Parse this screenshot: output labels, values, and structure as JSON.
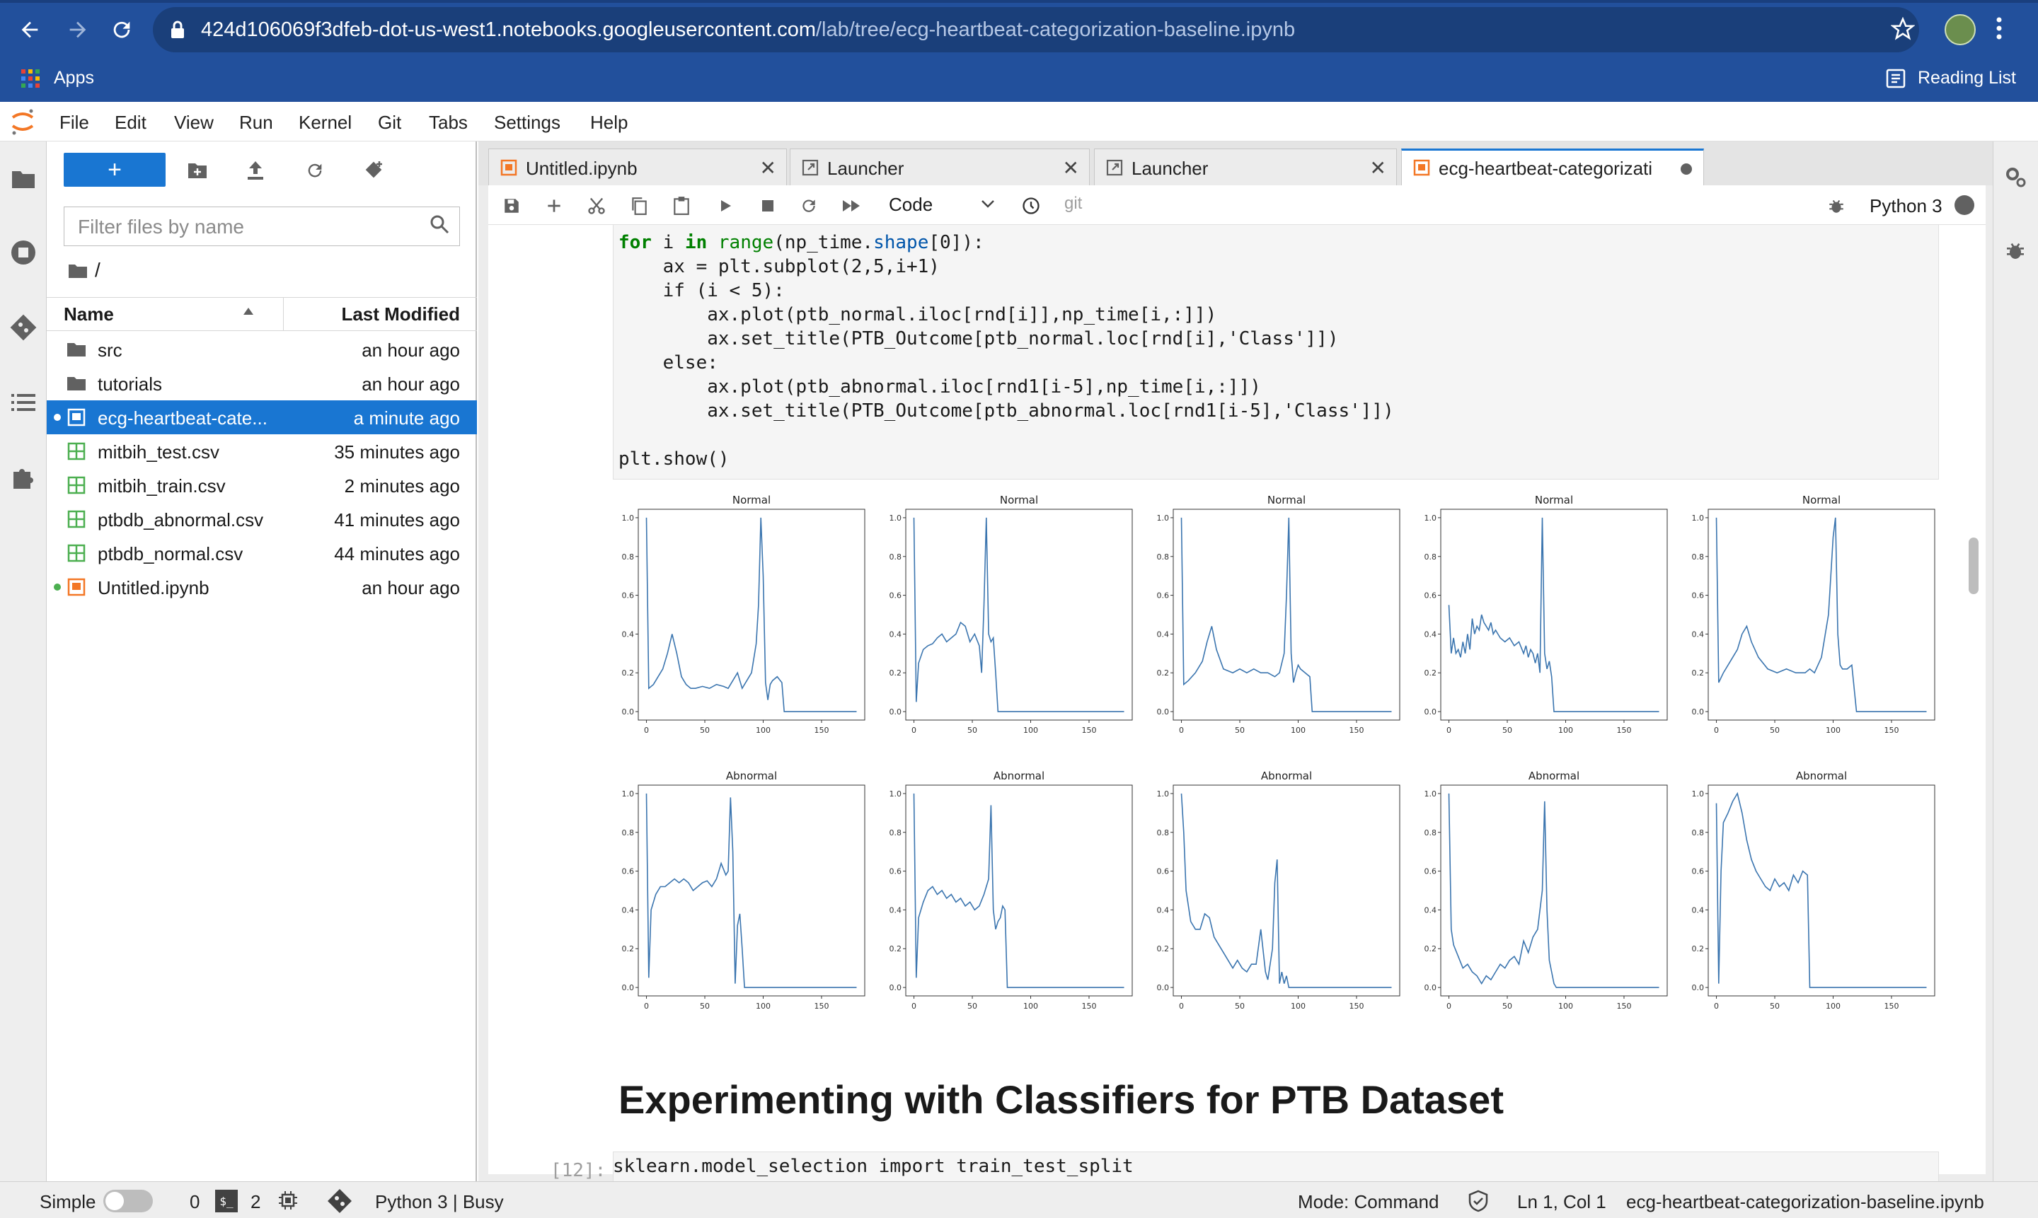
{
  "browser": {
    "url_host": "424d106069f3dfeb-dot-us-west1.notebooks.googleusercontent.com",
    "url_path": "/lab/tree/ecg-heartbeat-categorization-baseline.ipynb",
    "apps_label": "Apps",
    "reading_list_label": "Reading List"
  },
  "menu": [
    "File",
    "Edit",
    "View",
    "Run",
    "Kernel",
    "Git",
    "Tabs",
    "Settings",
    "Help"
  ],
  "file_browser": {
    "filter_placeholder": "Filter files by name",
    "breadcrumb": "/",
    "col_name": "Name",
    "col_modified": "Last Modified",
    "files": [
      {
        "name": "src",
        "modified": "an hour ago",
        "type": "folder"
      },
      {
        "name": "tutorials",
        "modified": "an hour ago",
        "type": "folder"
      },
      {
        "name": "ecg-heartbeat-cate...",
        "modified": "a minute ago",
        "type": "notebook",
        "selected": true
      },
      {
        "name": "mitbih_test.csv",
        "modified": "35 minutes ago",
        "type": "csv"
      },
      {
        "name": "mitbih_train.csv",
        "modified": "2 minutes ago",
        "type": "csv"
      },
      {
        "name": "ptbdb_abnormal.csv",
        "modified": "41 minutes ago",
        "type": "csv"
      },
      {
        "name": "ptbdb_normal.csv",
        "modified": "44 minutes ago",
        "type": "csv"
      },
      {
        "name": "Untitled.ipynb",
        "modified": "an hour ago",
        "type": "notebook"
      }
    ]
  },
  "tabs": [
    {
      "label": "Untitled.ipynb"
    },
    {
      "label": "Launcher"
    },
    {
      "label": "Launcher"
    },
    {
      "label": "ecg-heartbeat-categorizati"
    }
  ],
  "toolbar": {
    "cell_type": "Code",
    "git_label": "git",
    "kernel": "Python 3"
  },
  "code": {
    "line1": [
      "for",
      " i ",
      "in",
      " ",
      "range",
      "(np_time.",
      "shape",
      "[0]):"
    ],
    "line2": "    ax = plt.subplot(2,5,i+1)",
    "line3": "    if (i < 5):",
    "line4": "        ax.plot(ptb_normal.iloc[rnd[i]],np_time[i,:]])",
    "line5": "        ax.set_title(PTB_Outcome[ptb_normal.loc[rnd[i],'Class']])",
    "line6": "    else:",
    "line7": "        ax.plot(ptb_abnormal.iloc[rnd1[i-5],np_time[i,:]])",
    "line8": "        ax.set_title(PTB_Outcome[ptb_abnormal.loc[rnd1[i-5],'Class']])",
    "line9": "plt.show()"
  },
  "heading": "Experimenting with Classifiers for PTB Dataset",
  "next_cell": {
    "prompt": "[12]:",
    "code": "sklearn.model_selection import train_test_split"
  },
  "statusbar": {
    "mode_simple": "Simple",
    "count0": "0",
    "count2": "2",
    "kernel_status": "Python 3 | Busy",
    "mode": "Mode: Command",
    "cursor": "Ln 1, Col 1",
    "filename": "ecg-heartbeat-categorization-baseline.ipynb"
  },
  "chart_data": [
    {
      "type": "line",
      "title": "Normal",
      "xticks": [
        "0",
        "50",
        "100",
        "150"
      ],
      "yticks": [
        "0.0",
        "0.2",
        "0.4",
        "0.6",
        "0.8",
        "1.0"
      ],
      "ylim": [
        0,
        1
      ],
      "xlim": [
        -7,
        187
      ],
      "x": [
        0,
        2,
        6,
        10,
        14,
        18,
        22,
        26,
        30,
        34,
        38,
        42,
        48,
        54,
        60,
        66,
        70,
        74,
        78,
        82,
        86,
        90,
        94,
        96,
        98,
        100,
        102,
        104,
        106,
        108,
        112,
        116,
        118,
        120,
        122,
        126,
        140,
        160,
        180
      ],
      "y": [
        1.0,
        0.12,
        0.14,
        0.18,
        0.22,
        0.3,
        0.4,
        0.3,
        0.18,
        0.14,
        0.12,
        0.12,
        0.13,
        0.12,
        0.14,
        0.13,
        0.12,
        0.16,
        0.2,
        0.12,
        0.16,
        0.2,
        0.35,
        0.55,
        1.0,
        0.7,
        0.15,
        0.06,
        0.14,
        0.16,
        0.18,
        0.15,
        0.0,
        0.0,
        0.0,
        0.0,
        0.0,
        0.0,
        0.0
      ]
    },
    {
      "type": "line",
      "title": "Normal",
      "xticks": [
        "0",
        "50",
        "100",
        "150"
      ],
      "yticks": [
        "0.0",
        "0.2",
        "0.4",
        "0.6",
        "0.8",
        "1.0"
      ],
      "ylim": [
        0,
        1
      ],
      "xlim": [
        -7,
        187
      ],
      "x": [
        0,
        2,
        4,
        8,
        12,
        16,
        20,
        24,
        28,
        32,
        36,
        40,
        44,
        48,
        52,
        56,
        58,
        60,
        62,
        64,
        66,
        68,
        70,
        72,
        76,
        80,
        90,
        110,
        130,
        160,
        180
      ],
      "y": [
        1.0,
        0.05,
        0.25,
        0.32,
        0.34,
        0.35,
        0.38,
        0.4,
        0.36,
        0.38,
        0.4,
        0.46,
        0.44,
        0.36,
        0.4,
        0.34,
        0.2,
        0.55,
        1.0,
        0.4,
        0.36,
        0.38,
        0.2,
        0.0,
        0.0,
        0.0,
        0.0,
        0.0,
        0.0,
        0.0,
        0.0
      ]
    },
    {
      "type": "line",
      "title": "Normal",
      "xticks": [
        "0",
        "50",
        "100",
        "150"
      ],
      "yticks": [
        "0.0",
        "0.2",
        "0.4",
        "0.6",
        "0.8",
        "1.0"
      ],
      "ylim": [
        0,
        1
      ],
      "xlim": [
        -7,
        187
      ],
      "x": [
        0,
        2,
        6,
        12,
        18,
        22,
        26,
        30,
        36,
        44,
        50,
        56,
        62,
        68,
        74,
        80,
        84,
        88,
        90,
        92,
        94,
        96,
        98,
        100,
        102,
        106,
        110,
        112,
        116,
        130,
        150,
        180
      ],
      "y": [
        1.0,
        0.14,
        0.16,
        0.2,
        0.26,
        0.36,
        0.44,
        0.32,
        0.22,
        0.2,
        0.22,
        0.2,
        0.22,
        0.2,
        0.2,
        0.18,
        0.2,
        0.3,
        0.6,
        1.0,
        0.3,
        0.15,
        0.2,
        0.24,
        0.22,
        0.2,
        0.18,
        0.0,
        0.0,
        0.0,
        0.0,
        0.0
      ]
    },
    {
      "type": "line",
      "title": "Normal",
      "xticks": [
        "0",
        "50",
        "100",
        "150"
      ],
      "yticks": [
        "0.0",
        "0.2",
        "0.4",
        "0.6",
        "0.8",
        "1.0"
      ],
      "ylim": [
        0,
        1
      ],
      "xlim": [
        -7,
        187
      ],
      "x": [
        0,
        2,
        4,
        6,
        8,
        10,
        12,
        14,
        16,
        18,
        20,
        22,
        24,
        26,
        28,
        30,
        32,
        34,
        36,
        38,
        40,
        44,
        48,
        52,
        56,
        60,
        64,
        66,
        68,
        70,
        72,
        74,
        76,
        78,
        80,
        82,
        84,
        86,
        88,
        90,
        100,
        120,
        160,
        180
      ],
      "y": [
        0.55,
        0.3,
        0.38,
        0.3,
        0.32,
        0.28,
        0.36,
        0.3,
        0.4,
        0.32,
        0.48,
        0.4,
        0.44,
        0.42,
        0.5,
        0.46,
        0.44,
        0.42,
        0.46,
        0.4,
        0.42,
        0.38,
        0.36,
        0.38,
        0.34,
        0.36,
        0.3,
        0.34,
        0.28,
        0.32,
        0.3,
        0.25,
        0.3,
        0.2,
        1.0,
        0.3,
        0.22,
        0.26,
        0.18,
        0.0,
        0.0,
        0.0,
        0.0,
        0.0
      ]
    },
    {
      "type": "line",
      "title": "Normal",
      "xticks": [
        "0",
        "50",
        "100",
        "150"
      ],
      "yticks": [
        "0.0",
        "0.2",
        "0.4",
        "0.6",
        "0.8",
        "1.0"
      ],
      "ylim": [
        0,
        1
      ],
      "xlim": [
        -7,
        187
      ],
      "x": [
        0,
        2,
        6,
        12,
        18,
        22,
        26,
        30,
        36,
        44,
        52,
        60,
        68,
        76,
        80,
        84,
        90,
        96,
        100,
        102,
        104,
        106,
        108,
        112,
        116,
        120,
        124,
        130,
        150,
        180
      ],
      "y": [
        1.0,
        0.15,
        0.2,
        0.26,
        0.32,
        0.4,
        0.44,
        0.36,
        0.28,
        0.22,
        0.2,
        0.22,
        0.2,
        0.2,
        0.22,
        0.2,
        0.28,
        0.5,
        0.9,
        1.0,
        0.4,
        0.24,
        0.22,
        0.22,
        0.24,
        0.0,
        0.0,
        0.0,
        0.0,
        0.0
      ]
    },
    {
      "type": "line",
      "title": "Abnormal",
      "xticks": [
        "0",
        "50",
        "100",
        "150"
      ],
      "yticks": [
        "0.0",
        "0.2",
        "0.4",
        "0.6",
        "0.8",
        "1.0"
      ],
      "ylim": [
        0,
        1
      ],
      "xlim": [
        -7,
        187
      ],
      "x": [
        0,
        2,
        4,
        8,
        12,
        16,
        20,
        24,
        28,
        32,
        36,
        40,
        44,
        48,
        52,
        56,
        60,
        64,
        68,
        70,
        72,
        74,
        76,
        78,
        80,
        82,
        84,
        90,
        110,
        150,
        180
      ],
      "y": [
        1.0,
        0.05,
        0.4,
        0.48,
        0.52,
        0.52,
        0.54,
        0.56,
        0.54,
        0.56,
        0.54,
        0.5,
        0.52,
        0.54,
        0.55,
        0.52,
        0.56,
        0.64,
        0.58,
        0.6,
        0.98,
        0.7,
        0.02,
        0.32,
        0.38,
        0.2,
        0.0,
        0.0,
        0.0,
        0.0,
        0.0
      ]
    },
    {
      "type": "line",
      "title": "Abnormal",
      "xticks": [
        "0",
        "50",
        "100",
        "150"
      ],
      "yticks": [
        "0.0",
        "0.2",
        "0.4",
        "0.6",
        "0.8",
        "1.0"
      ],
      "ylim": [
        0,
        1
      ],
      "xlim": [
        -7,
        187
      ],
      "x": [
        0,
        2,
        4,
        8,
        12,
        16,
        20,
        24,
        28,
        32,
        36,
        40,
        44,
        48,
        52,
        56,
        60,
        64,
        66,
        68,
        70,
        72,
        74,
        76,
        78,
        80,
        84,
        90,
        110,
        150,
        180
      ],
      "y": [
        1.0,
        0.05,
        0.36,
        0.44,
        0.5,
        0.52,
        0.48,
        0.5,
        0.46,
        0.48,
        0.44,
        0.46,
        0.42,
        0.44,
        0.4,
        0.42,
        0.48,
        0.56,
        0.94,
        0.4,
        0.3,
        0.34,
        0.36,
        0.42,
        0.4,
        0.0,
        0.0,
        0.0,
        0.0,
        0.0,
        0.0
      ]
    },
    {
      "type": "line",
      "title": "Abnormal",
      "xticks": [
        "0",
        "50",
        "100",
        "150"
      ],
      "yticks": [
        "0.0",
        "0.2",
        "0.4",
        "0.6",
        "0.8",
        "1.0"
      ],
      "ylim": [
        0,
        1
      ],
      "xlim": [
        -7,
        187
      ],
      "x": [
        0,
        2,
        4,
        8,
        12,
        16,
        20,
        24,
        28,
        32,
        36,
        40,
        44,
        48,
        52,
        56,
        60,
        64,
        68,
        72,
        74,
        76,
        78,
        80,
        82,
        84,
        86,
        88,
        90,
        92,
        94,
        100,
        110,
        140,
        180
      ],
      "y": [
        1.0,
        0.8,
        0.5,
        0.34,
        0.3,
        0.3,
        0.38,
        0.36,
        0.26,
        0.22,
        0.18,
        0.14,
        0.1,
        0.14,
        0.1,
        0.08,
        0.12,
        0.12,
        0.3,
        0.08,
        0.04,
        0.12,
        0.2,
        0.54,
        0.66,
        0.02,
        0.08,
        0.02,
        0.06,
        0.0,
        0.0,
        0.0,
        0.0,
        0.0,
        0.0
      ]
    },
    {
      "type": "line",
      "title": "Abnormal",
      "xticks": [
        "0",
        "50",
        "100",
        "150"
      ],
      "yticks": [
        "0.0",
        "0.2",
        "0.4",
        "0.6",
        "0.8",
        "1.0"
      ],
      "ylim": [
        0,
        1
      ],
      "xlim": [
        -7,
        187
      ],
      "x": [
        0,
        2,
        4,
        8,
        12,
        16,
        20,
        24,
        28,
        32,
        36,
        40,
        44,
        48,
        52,
        56,
        60,
        64,
        68,
        72,
        76,
        80,
        82,
        84,
        86,
        88,
        90,
        92,
        100,
        120,
        180
      ],
      "y": [
        1.0,
        0.3,
        0.22,
        0.16,
        0.1,
        0.12,
        0.08,
        0.06,
        0.02,
        0.06,
        0.04,
        0.08,
        0.12,
        0.1,
        0.14,
        0.16,
        0.12,
        0.24,
        0.18,
        0.26,
        0.3,
        0.5,
        0.96,
        0.4,
        0.14,
        0.08,
        0.02,
        0.0,
        0.0,
        0.0,
        0.0
      ]
    },
    {
      "type": "line",
      "title": "Abnormal",
      "xticks": [
        "0",
        "50",
        "100",
        "150"
      ],
      "yticks": [
        "0.0",
        "0.2",
        "0.4",
        "0.6",
        "0.8",
        "1.0"
      ],
      "ylim": [
        0,
        1
      ],
      "xlim": [
        -7,
        187
      ],
      "x": [
        0,
        2,
        4,
        6,
        10,
        14,
        18,
        22,
        26,
        30,
        34,
        38,
        42,
        46,
        50,
        54,
        58,
        62,
        66,
        70,
        74,
        78,
        80,
        82,
        84,
        90,
        120,
        180
      ],
      "y": [
        0.95,
        0.02,
        0.6,
        0.85,
        0.9,
        0.96,
        1.0,
        0.9,
        0.76,
        0.66,
        0.6,
        0.56,
        0.52,
        0.5,
        0.56,
        0.52,
        0.54,
        0.5,
        0.58,
        0.54,
        0.6,
        0.58,
        0.0,
        0.0,
        0.0,
        0.0,
        0.0,
        0.0
      ]
    }
  ]
}
